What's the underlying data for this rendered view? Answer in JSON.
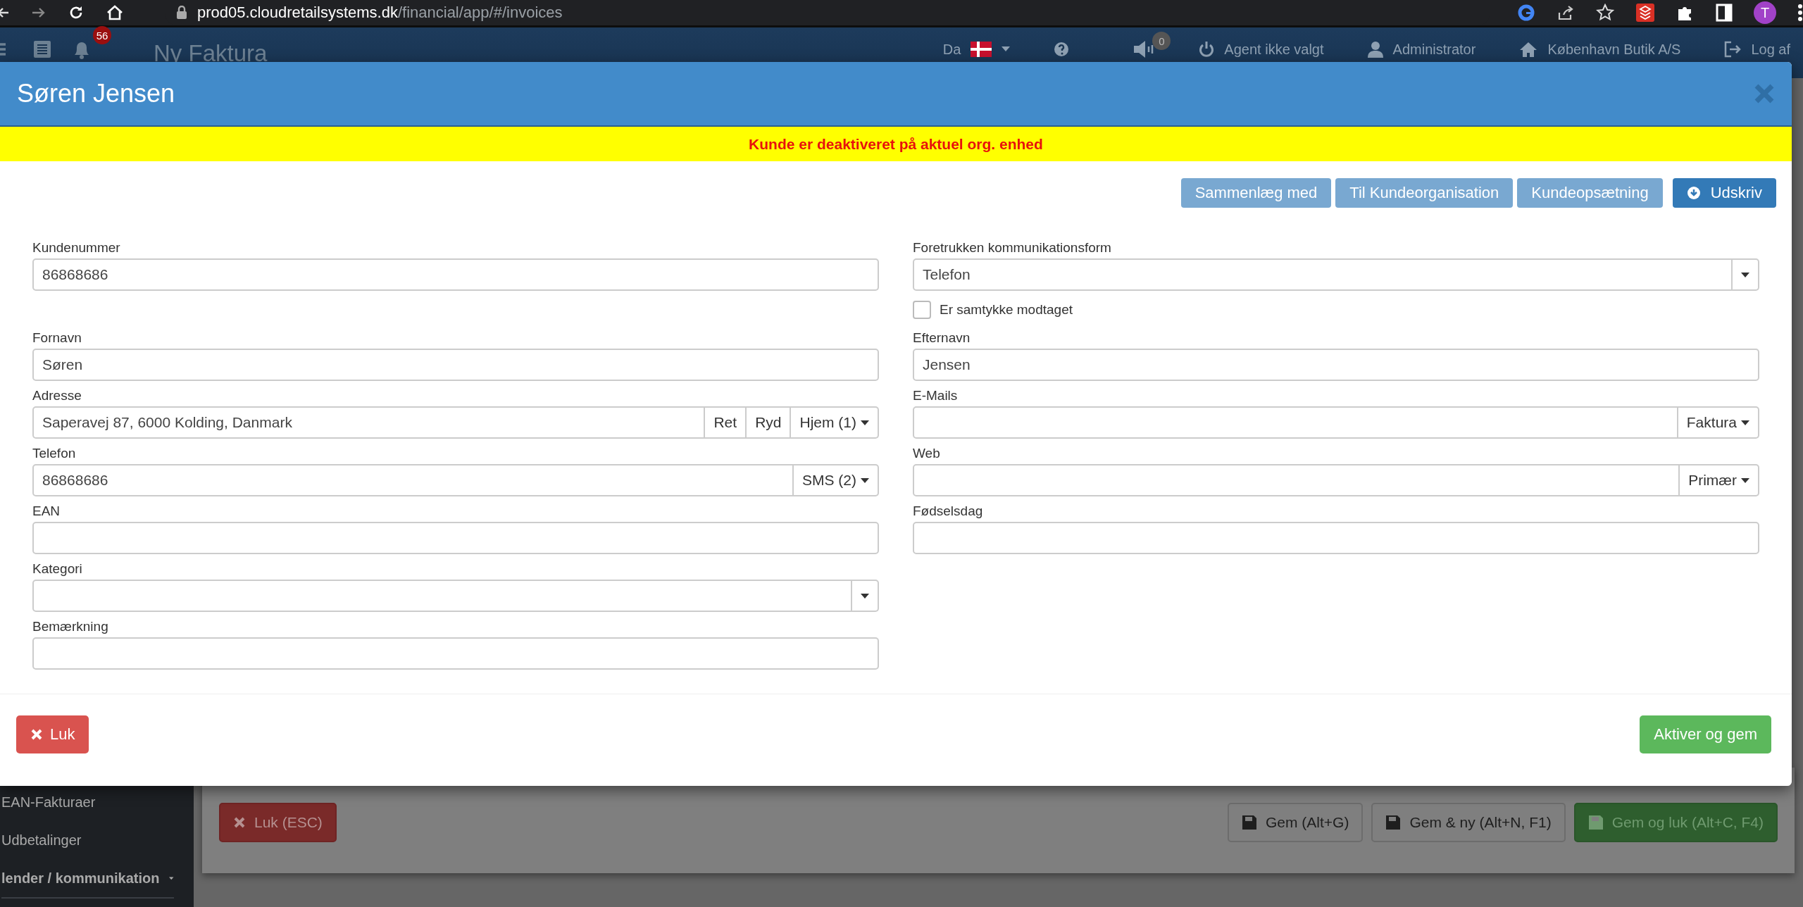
{
  "browser": {
    "url_host": "prod05.cloudretailsystems.dk",
    "url_path": "/financial/app/#/invoices",
    "profile_initial": "T"
  },
  "navbar": {
    "notification_count": "56",
    "title": "Ny Faktura",
    "language": "Da",
    "sound_count": "0",
    "agent": "Agent ikke valgt",
    "user": "Administrator",
    "shop": "København Butik A/S",
    "logout": "Log af"
  },
  "sidebar": {
    "items": [
      {
        "label": "EAN-Fakturaer",
        "expandable": false
      },
      {
        "label": "Udbetalinger",
        "expandable": false
      },
      {
        "label": "lender / kommunikation",
        "expandable": true
      }
    ]
  },
  "page_actions": [
    {
      "label": "Luk (ESC)",
      "kind": "close"
    },
    {
      "label": "Gem (Alt+G)",
      "kind": "save"
    },
    {
      "label": "Gem & ny (Alt+N, F1)",
      "kind": "save"
    },
    {
      "label": "Gem og luk (Alt+C, F4)",
      "kind": "save-primary"
    }
  ],
  "dialog": {
    "title": "Søren Jensen",
    "warning": "Kunde er deaktiveret på aktuel org. enhed",
    "toolbar": [
      {
        "label": "Sammenlæg med",
        "disabled": true,
        "kind": "plain"
      },
      {
        "label": "Til Kundeorganisation",
        "disabled": true,
        "kind": "plain"
      },
      {
        "label": "Kundeopsætning",
        "disabled": true,
        "kind": "plain"
      },
      {
        "label": "Udskriv",
        "disabled": false,
        "kind": "print"
      }
    ],
    "rows": [
      {
        "left": {
          "label": "Kundenummer",
          "kind": "text",
          "value": "86868686"
        },
        "right": {
          "label": "Foretrukken kommunikationsform",
          "kind": "select",
          "value": "Telefon",
          "checkbox": {
            "label": "Er samtykke modtaget",
            "checked": false
          }
        }
      },
      {
        "left": {
          "label": "Fornavn",
          "kind": "text",
          "value": "Søren"
        },
        "right": {
          "label": "Efternavn",
          "kind": "text",
          "value": "Jensen"
        }
      },
      {
        "left": {
          "label": "Adresse",
          "kind": "addon",
          "value": "Saperavej 87, 6000 Kolding, Danmark",
          "addons": [
            {
              "label": "Ret",
              "caret": false
            },
            {
              "label": "Ryd",
              "caret": false
            },
            {
              "label": "Hjem (1)",
              "caret": true
            }
          ]
        },
        "right": {
          "label": "E-Mails",
          "kind": "addon",
          "addons": [
            {
              "label": "Faktura",
              "caret": true
            }
          ]
        }
      },
      {
        "left": {
          "label": "Telefon",
          "kind": "addon",
          "value": "86868686",
          "addons": [
            {
              "label": "SMS (2)",
              "caret": true
            }
          ]
        },
        "right": {
          "label": "Web",
          "kind": "addon",
          "addons": [
            {
              "label": "Primær",
              "caret": true
            }
          ]
        }
      },
      {
        "left": {
          "label": "EAN",
          "kind": "text"
        },
        "right": {
          "label": "Fødselsdag",
          "kind": "text"
        }
      },
      {
        "left": {
          "label": "Kategori",
          "kind": "select"
        }
      },
      {
        "left": {
          "label": "Bemærkning",
          "kind": "text"
        }
      }
    ],
    "footer": [
      {
        "label": "Luk",
        "kind": "close"
      },
      {
        "label": "Aktiver og gem",
        "kind": "activate"
      }
    ]
  }
}
